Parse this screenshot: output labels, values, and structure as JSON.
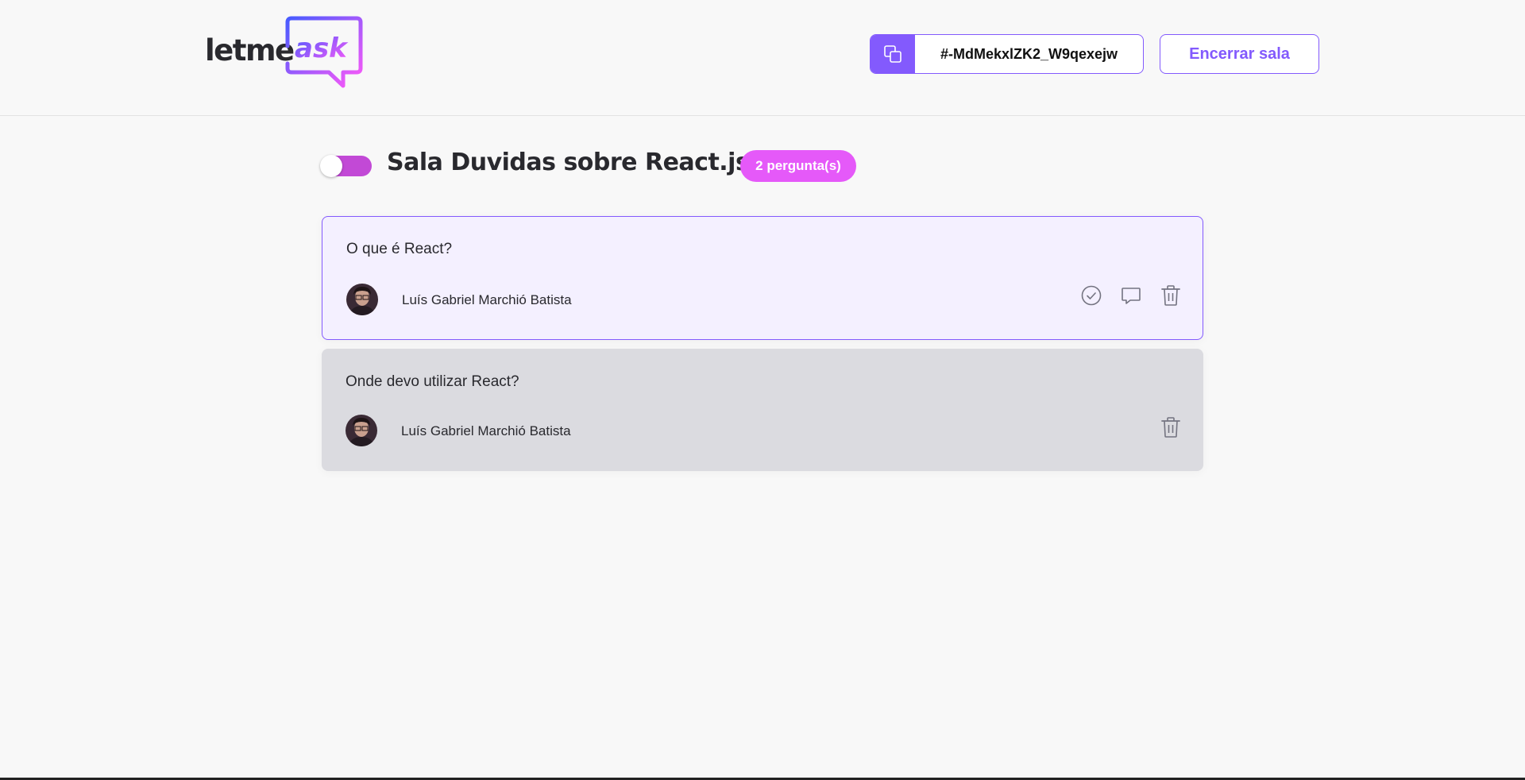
{
  "header": {
    "logo_text": "letme",
    "logo_accent": "ask",
    "room_code": "#-MdMekxlZK2_W9qexejw",
    "close_room_label": "Encerrar sala"
  },
  "room": {
    "title": "Sala Duvidas sobre React.js",
    "question_count": "2 pergunta(s)",
    "toggle_on": true
  },
  "questions": [
    {
      "content": "O que é React?",
      "author": "Luís Gabriel Marchió Batista",
      "state": "highlighted",
      "actions": [
        "check-icon",
        "answer-icon",
        "delete-icon"
      ]
    },
    {
      "content": "Onde devo utilizar React?",
      "author": "Luís Gabriel Marchió Batista",
      "state": "answered",
      "actions": [
        "delete-icon"
      ]
    }
  ],
  "colors": {
    "brand": "#835afd",
    "accent": "#e559f9",
    "toggle": "#c249d6",
    "highlighted_bg": "#f4f0ff",
    "answered_bg": "#dbdbe0"
  }
}
